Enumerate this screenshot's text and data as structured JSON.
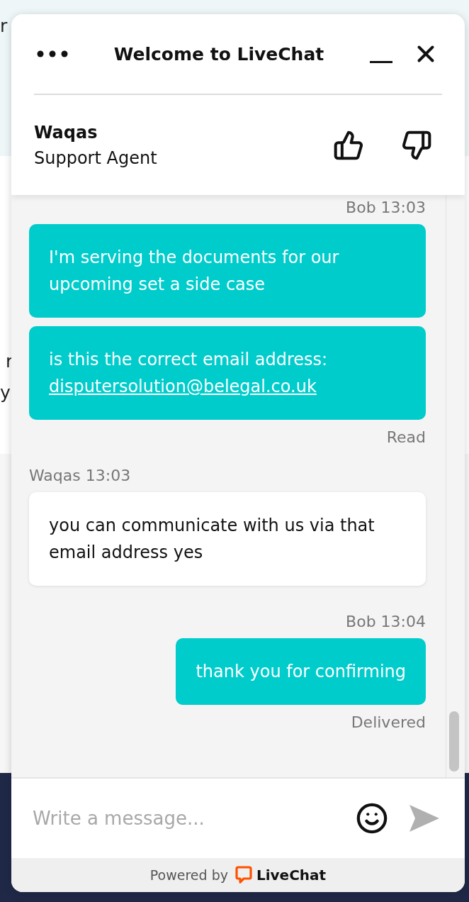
{
  "background_page": {
    "top_text": "r",
    "panel_texts": [
      "r",
      "y"
    ]
  },
  "widget": {
    "title": "Welcome to LiveChat",
    "agent": {
      "name": "Waqas",
      "role": "Support Agent"
    },
    "groups": [
      {
        "kind": "visitor",
        "header": "Bob 13:03",
        "bubbles": [
          {
            "text": "I'm serving the documents for our upcoming set a side case"
          },
          {
            "text": "is this the correct email address:",
            "link": "disputersolution@belegal.co.uk"
          }
        ],
        "status": "Read"
      },
      {
        "kind": "agent",
        "header": "Waqas 13:03",
        "bubbles": [
          {
            "text": "you can communicate with us via that email address yes"
          }
        ]
      },
      {
        "kind": "visitor",
        "header": "Bob 13:04",
        "bubbles": [
          {
            "text": "thank you for confirming"
          }
        ],
        "status": "Delivered"
      }
    ],
    "composer": {
      "placeholder": "Write a message..."
    },
    "footer": {
      "powered_by": "Powered by",
      "brand": "LiveChat"
    }
  }
}
